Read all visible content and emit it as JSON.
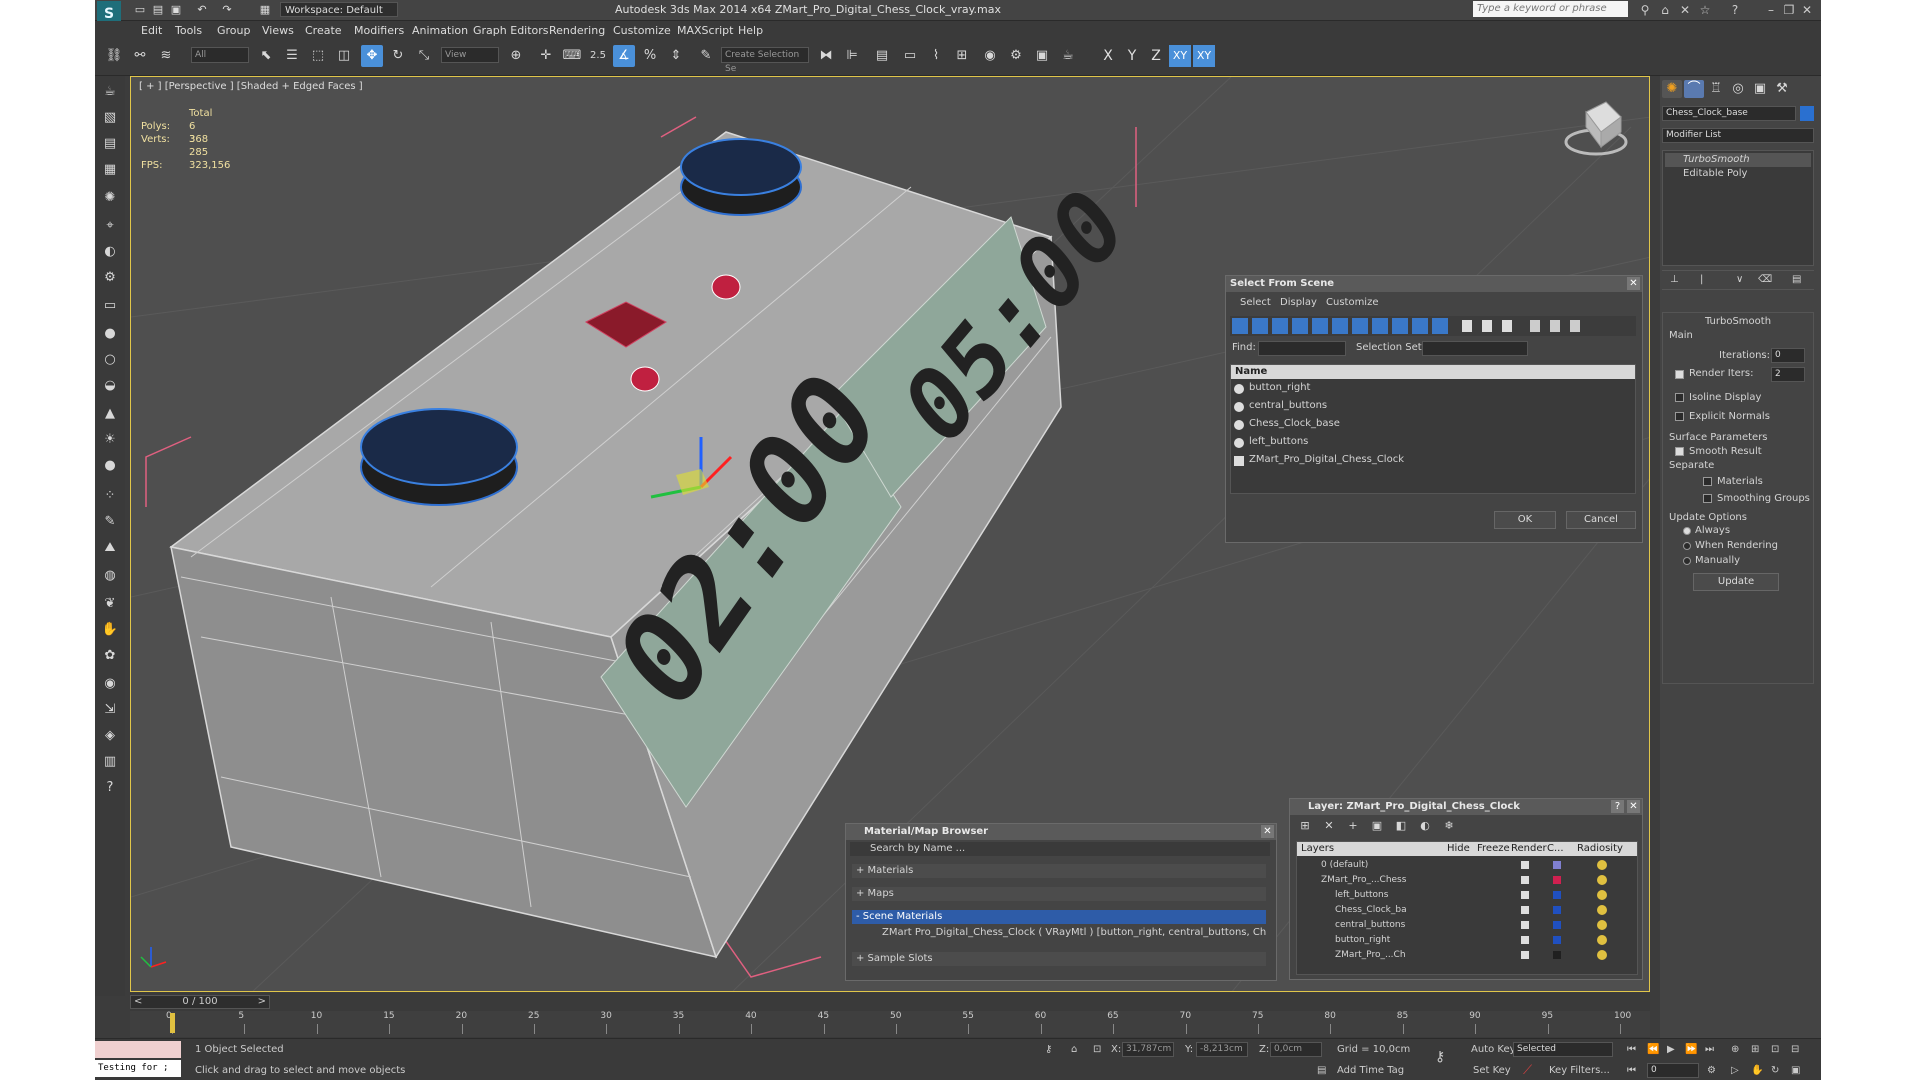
{
  "titlebar": {
    "workspace": "Workspace: Default",
    "title": "Autodesk 3ds Max  2014 x64     ZMart_Pro_Digital_Chess_Clock_vray.max",
    "search_placeholder": "Type a keyword or phrase"
  },
  "menus": [
    "Edit",
    "Tools",
    "Group",
    "Views",
    "Create",
    "Modifiers",
    "Animation",
    "Graph Editors",
    "Rendering",
    "Customize",
    "MAXScript",
    "Help"
  ],
  "toolbar": {
    "filter": "All",
    "ref_coord": "View",
    "snap_label": "2.5",
    "selection_set": "Create Selection Se",
    "axes": [
      "X",
      "Y",
      "Z",
      "XY",
      "XY"
    ]
  },
  "viewport": {
    "label": "[ + ] [Perspective ] [Shaded + Edged Faces ]",
    "stats": {
      "total_label": "Total",
      "polys_label": "Polys:",
      "polys": "6 368",
      "verts_label": "Verts:",
      "verts": "3 285",
      "fps_label": "FPS:",
      "fps": "323,156"
    },
    "screen_left": "02:00",
    "screen_right": "05:00"
  },
  "command_panel": {
    "object_name": "Chess_Clock_base",
    "modifier_list": "Modifier List",
    "stack": [
      "TurboSmooth",
      "Editable Poly"
    ],
    "rollout_title": "TurboSmooth",
    "main_label": "Main",
    "iterations_label": "Iterations:",
    "iterations": "0",
    "render_iters_label": "Render Iters:",
    "render_iters": "2",
    "isoline": "Isoline Display",
    "explicit_normals": "Explicit Normals",
    "surface_params": "Surface Parameters",
    "smooth_result": "Smooth Result",
    "separate": "Separate",
    "materials": "Materials",
    "smoothing_groups": "Smoothing Groups",
    "update_options": "Update Options",
    "always": "Always",
    "when_rendering": "When Rendering",
    "manually": "Manually",
    "update": "Update"
  },
  "select_dialog": {
    "title": "Select From Scene",
    "menus": [
      "Select",
      "Display",
      "Customize"
    ],
    "find_label": "Find:",
    "selection_set_label": "Selection Set:",
    "column": "Name",
    "items": [
      "button_right",
      "central_buttons",
      "Chess_Clock_base",
      "left_buttons",
      "ZMart_Pro_Digital_Chess_Clock"
    ],
    "ok": "OK",
    "cancel": "Cancel"
  },
  "material_browser": {
    "title": "Material/Map Browser",
    "search": "Search by Name ...",
    "groups": [
      "+ Materials",
      "+ Maps",
      "- Scene Materials"
    ],
    "scene_material": "ZMart Pro_Digital_Chess_Clock  ( VRayMtl ) [button_right, central_buttons, Ches...",
    "sample_slots": "+ Sample Slots"
  },
  "layer_dialog": {
    "title": "Layer: ZMart_Pro_Digital_Chess_Clock",
    "help": "?",
    "columns": [
      "Layers",
      "Hide",
      "Freeze",
      "Render",
      "C...",
      "Radiosity"
    ],
    "rows": [
      {
        "name": "0 (default)",
        "color": "#8080d0"
      },
      {
        "name": "ZMart_Pro_...Chess",
        "color": "#d02050"
      },
      {
        "name": "left_buttons",
        "color": "#2050c0"
      },
      {
        "name": "Chess_Clock_ba",
        "color": "#2050c0"
      },
      {
        "name": "central_buttons",
        "color": "#2050c0"
      },
      {
        "name": "button_right",
        "color": "#2050c0"
      },
      {
        "name": "ZMart_Pro_...Ch",
        "color": "#202020"
      }
    ]
  },
  "timeline": {
    "frame": "0 / 100",
    "ticks": [
      "0",
      "5",
      "10",
      "15",
      "20",
      "25",
      "30",
      "35",
      "40",
      "45",
      "50",
      "55",
      "60",
      "65",
      "70",
      "75",
      "80",
      "85",
      "90",
      "95",
      "100"
    ]
  },
  "status": {
    "maxscript": "Testing for ;",
    "selected": "1 Object Selected",
    "prompt": "Click and drag to select and move objects",
    "x_label": "X:",
    "x": "31,787cm",
    "y_label": "Y:",
    "y": "-8,213cm",
    "z_label": "Z:",
    "z": "0,0cm",
    "grid": "Grid = 10,0cm",
    "add_time_tag": "Add Time Tag",
    "auto_key": "Auto Key",
    "auto_key_mode": "Selected",
    "set_key": "Set Key",
    "key_filters": "Key Filters...",
    "frame_field": "0"
  }
}
